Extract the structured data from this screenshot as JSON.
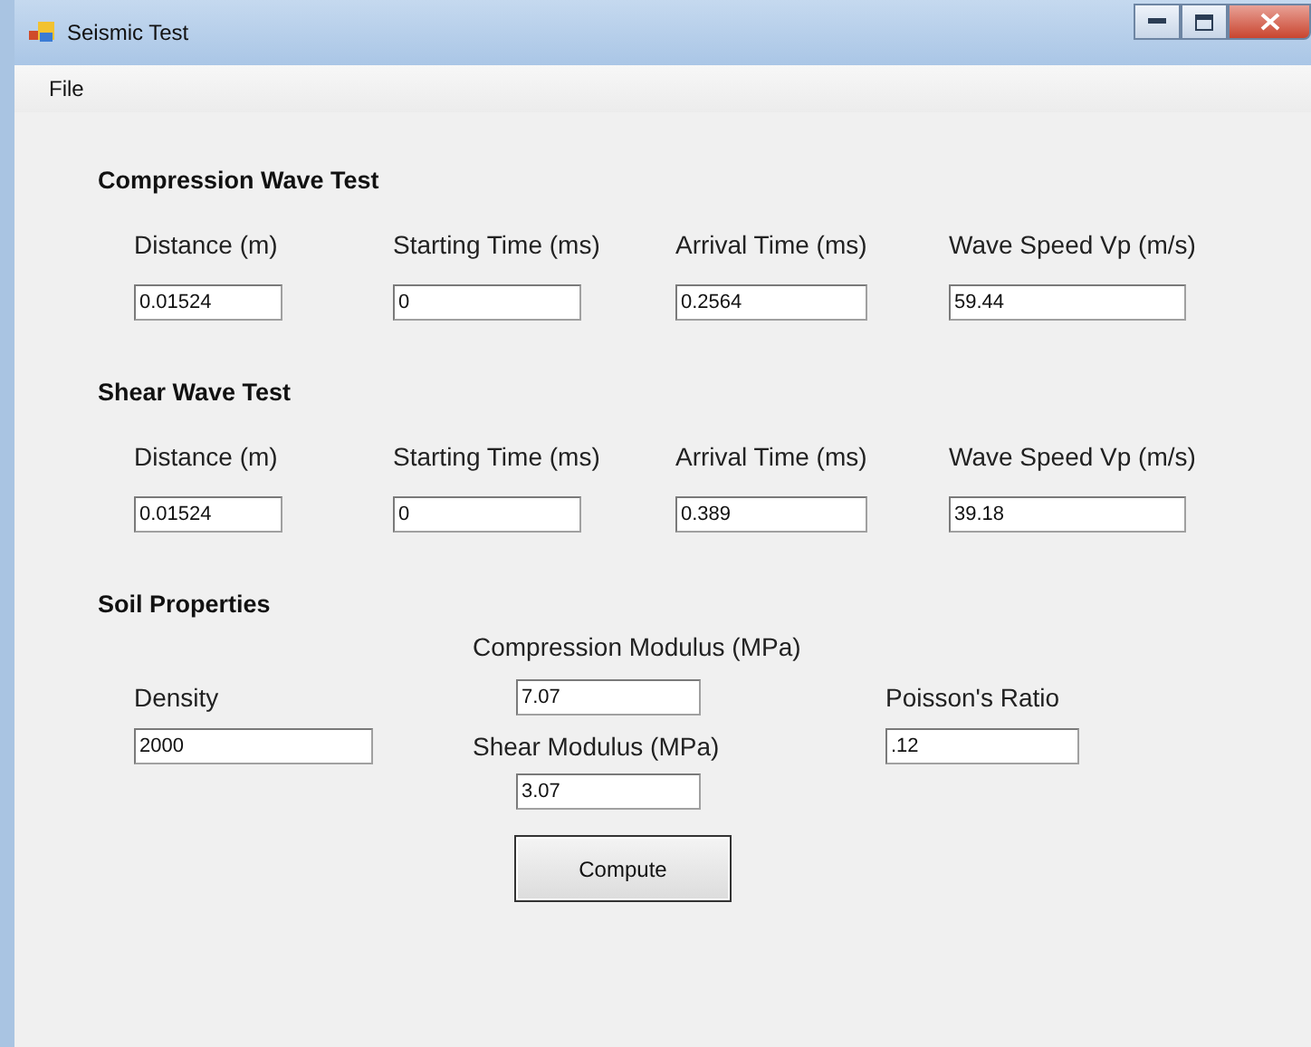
{
  "window": {
    "title": "Seismic Test"
  },
  "menu": [
    "File"
  ],
  "wave_tests": [
    {
      "title": "Compression Wave Test",
      "fields": [
        {
          "label": "Distance (m)",
          "value": "0.01524"
        },
        {
          "label": "Starting Time (ms)",
          "value": "0"
        },
        {
          "label": "Arrival Time (ms)",
          "value": "0.2564"
        },
        {
          "label": "Wave Speed Vp (m/s)",
          "value": "59.44"
        }
      ]
    },
    {
      "title": "Shear Wave Test",
      "fields": [
        {
          "label": "Distance (m)",
          "value": "0.01524"
        },
        {
          "label": "Starting Time (ms)",
          "value": "0"
        },
        {
          "label": "Arrival Time (ms)",
          "value": "0.389"
        },
        {
          "label": "Wave Speed Vp (m/s)",
          "value": "39.18"
        }
      ]
    }
  ],
  "soil_properties": {
    "title": "Soil Properties",
    "density": {
      "label": "Density",
      "value": "2000"
    },
    "compression_modulus": {
      "label": "Compression Modulus (MPa)",
      "value": "7.07"
    },
    "shear_modulus": {
      "label": "Shear Modulus (MPa)",
      "value": "3.07"
    },
    "poissons_ratio": {
      "label": "Poisson's Ratio",
      "value": ".12"
    }
  },
  "compute_button": "Compute"
}
